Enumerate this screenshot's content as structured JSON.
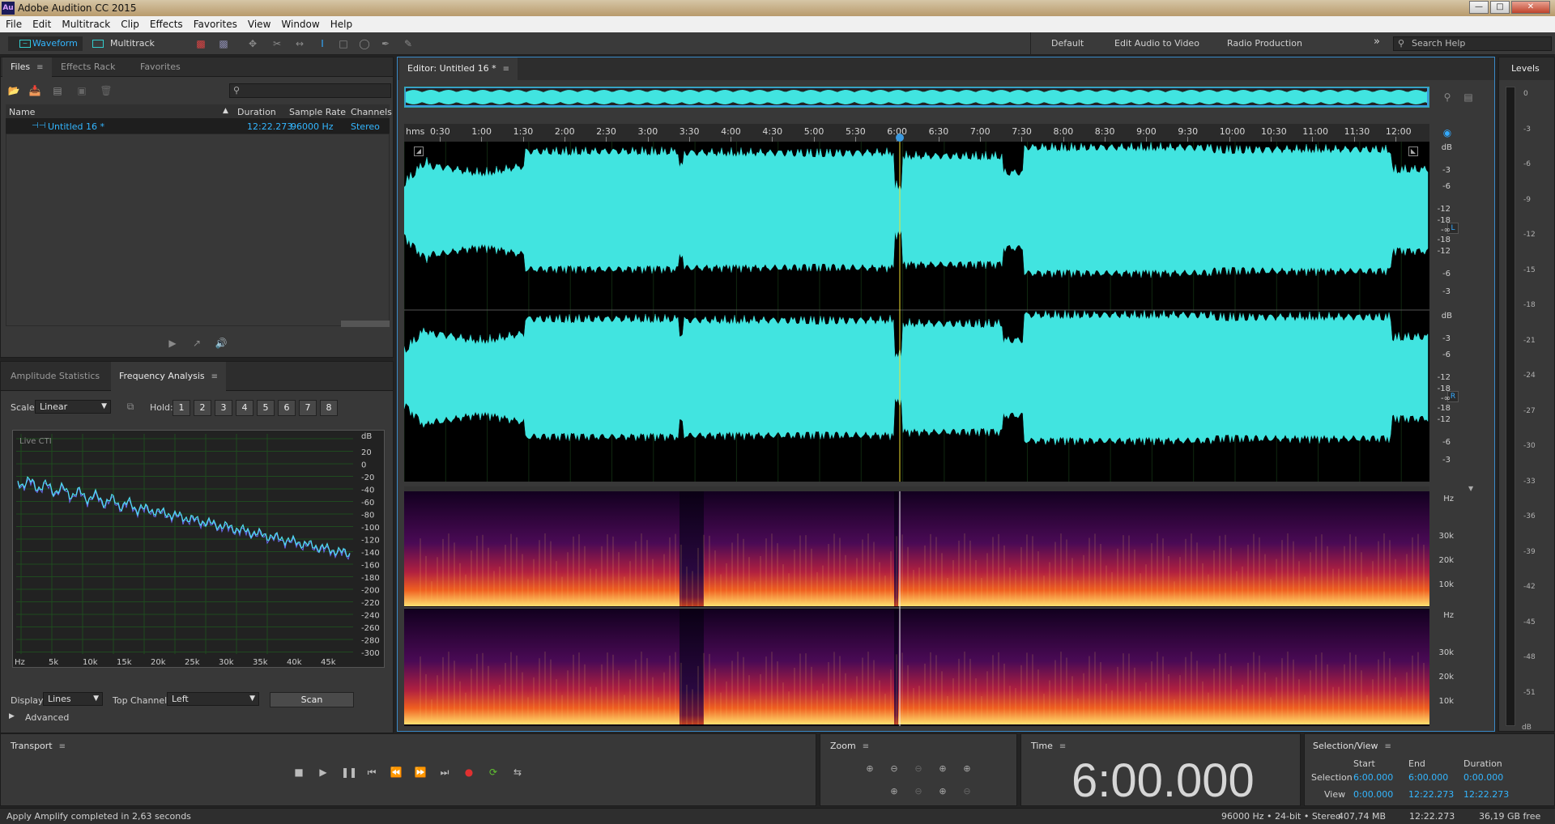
{
  "app": {
    "title": "Adobe Audition CC 2015",
    "icon_text": "Au"
  },
  "menu": [
    "File",
    "Edit",
    "Multitrack",
    "Clip",
    "Effects",
    "Favorites",
    "View",
    "Window",
    "Help"
  ],
  "toolbar": {
    "waveform": "Waveform",
    "multitrack": "Multitrack",
    "workspaces": [
      "Default",
      "Edit Audio to Video",
      "Radio Production"
    ],
    "more": "»",
    "search_placeholder": "Search Help"
  },
  "files_panel": {
    "tabs": [
      "Files",
      "Effects Rack",
      "Favorites"
    ],
    "columns": [
      "Name",
      "Duration",
      "Sample Rate",
      "Channels"
    ],
    "rows": [
      {
        "name": "Untitled 16 *",
        "duration": "12:22.273",
        "sample_rate": "96000 Hz",
        "channels": "Stereo"
      }
    ],
    "search_icon": "search-icon"
  },
  "analysis_panel": {
    "tabs": [
      "Amplitude Statistics",
      "Frequency Analysis"
    ],
    "scale_label": "Scale:",
    "scale_value": "Linear",
    "hold_label": "Hold:",
    "hold_buttons": [
      "1",
      "2",
      "3",
      "4",
      "5",
      "6",
      "7",
      "8"
    ],
    "hold_colors": [
      "#e02020",
      "#f08020",
      "#f0e020",
      "#40c040",
      "#30c0a0",
      "#30c8f0",
      "#4060f0",
      "#e040e0"
    ],
    "live_label": "Live CTI",
    "db_unit": "dB",
    "db_ticks": [
      "20",
      "0",
      "-20",
      "-40",
      "-60",
      "-80",
      "-100",
      "-120",
      "-140",
      "-160",
      "-180",
      "-200",
      "-220",
      "-240",
      "-260",
      "-280",
      "-300"
    ],
    "hz_ticks": [
      "Hz",
      "5k",
      "10k",
      "15k",
      "20k",
      "25k",
      "30k",
      "35k",
      "40k",
      "45k"
    ],
    "display_label": "Display:",
    "display_value": "Lines",
    "top_channel_label": "Top Channel:",
    "top_channel_value": "Left",
    "scan_label": "Scan",
    "advanced_label": "Advanced"
  },
  "editor": {
    "title": "Editor: Untitled 16 *",
    "ruler_unit": "hms",
    "ruler_ticks": [
      "0:30",
      "1:00",
      "1:30",
      "2:00",
      "2:30",
      "3:00",
      "3:30",
      "4:00",
      "4:30",
      "5:00",
      "5:30",
      "6:00",
      "6:30",
      "7:00",
      "7:30",
      "8:00",
      "8:30",
      "9:00",
      "9:30",
      "10:00",
      "10:30",
      "11:00",
      "11:30",
      "12:00"
    ],
    "db_unit": "dB",
    "db_scale": [
      "-3",
      "-6",
      "-12",
      "-18",
      "-∞",
      "-18",
      "-12",
      "-6",
      "-3"
    ],
    "channel_left": "L",
    "channel_right": "R",
    "hz_unit": "Hz",
    "hz_scale": [
      "30k",
      "20k",
      "10k"
    ],
    "wave_color": "#41e4e0"
  },
  "levels": {
    "title": "Levels",
    "ticks": [
      "0",
      "-3",
      "-6",
      "-9",
      "-12",
      "-15",
      "-18",
      "-21",
      "-24",
      "-27",
      "-30",
      "-33",
      "-36",
      "-39",
      "-42",
      "-45",
      "-48",
      "-51",
      "dB"
    ]
  },
  "transport": {
    "title": "Transport"
  },
  "zoom": {
    "title": "Zoom"
  },
  "time": {
    "title": "Time",
    "value": "6:00.000"
  },
  "selection": {
    "title": "Selection/View",
    "col_start": "Start",
    "col_end": "End",
    "col_duration": "Duration",
    "row_selection": "Selection",
    "row_view": "View",
    "sel_start": "6:00.000",
    "sel_end": "6:00.000",
    "sel_duration": "0:00.000",
    "view_start": "0:00.000",
    "view_end": "12:22.273",
    "view_duration": "12:22.273"
  },
  "status": {
    "message": "Apply Amplify completed in 2,63 seconds",
    "format": "96000 Hz • 24-bit • Stereo",
    "size": "407,74 MB",
    "duration": "12:22.273",
    "free": "36,19 GB free"
  }
}
